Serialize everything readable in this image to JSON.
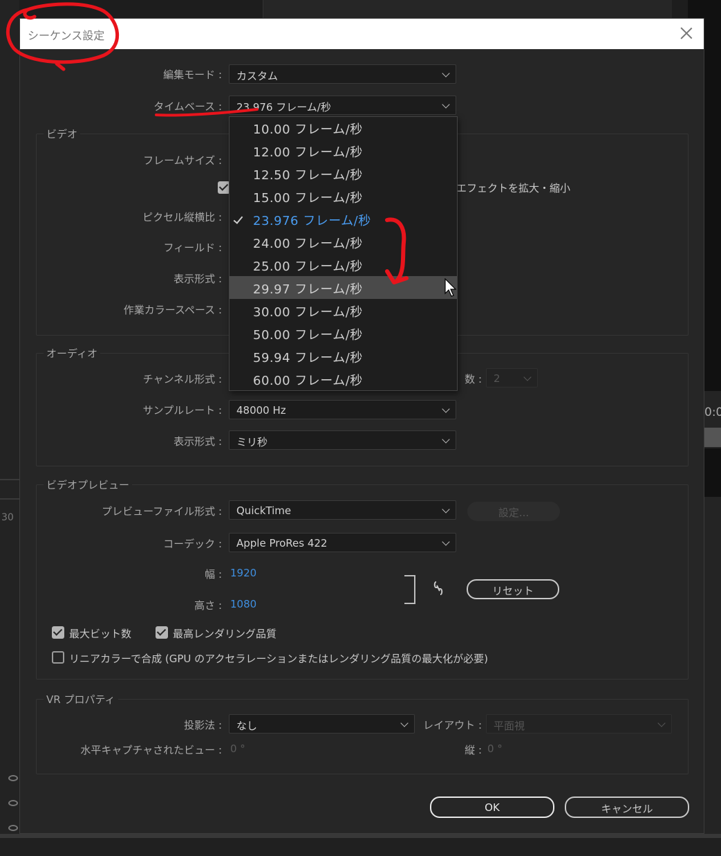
{
  "dialog": {
    "title": "シーケンス設定",
    "close_icon": "close-icon"
  },
  "editing_mode": {
    "label": "編集モード",
    "value": "カスタム"
  },
  "timebase": {
    "label": "タイムベース",
    "value": "23.976  フレーム/秒",
    "options": [
      "10.00  フレーム/秒",
      "12.00  フレーム/秒",
      "12.50  フレーム/秒",
      "15.00  フレーム/秒",
      "23.976  フレーム/秒",
      "24.00  フレーム/秒",
      "25.00  フレーム/秒",
      "29.97  フレーム/秒",
      "30.00  フレーム/秒",
      "50.00  フレーム/秒",
      "59.94  フレーム/秒",
      "60.00  フレーム/秒"
    ],
    "selected_index": 4,
    "hovered_index": 7
  },
  "video": {
    "group_title": "ビデオ",
    "frame_size_label": "フレームサイズ",
    "scale_note": "エフェクトを拡大・縮小",
    "pixel_aspect_label": "ピクセル縦横比",
    "fields_label": "フィールド",
    "display_format_label": "表示形式",
    "color_space_label": "作業カラースペース"
  },
  "audio": {
    "group_title": "オーディオ",
    "channel_format_label": "チャンネル形式",
    "channels_suffix": "数",
    "channels_value": "2",
    "sample_rate_label": "サンプルレート",
    "sample_rate_value": "48000 Hz",
    "display_format_label": "表示形式",
    "display_format_value": "ミリ秒"
  },
  "video_preview": {
    "group_title": "ビデオプレビュー",
    "preview_format_label": "プレビューファイル形式",
    "preview_format_value": "QuickTime",
    "settings_button": "設定...",
    "codec_label": "コーデック",
    "codec_value": "Apple ProRes 422",
    "width_label": "幅",
    "width_value": "1920",
    "height_label": "高さ",
    "height_value": "1080",
    "reset_button": "リセット",
    "max_bit_depth": {
      "label": "最大ビット数",
      "checked": true
    },
    "max_render_quality": {
      "label": "最高レンダリング品質",
      "checked": true
    },
    "linear_color": {
      "label": "リニアカラーで合成 (GPU のアクセラレーションまたはレンダリング品質の最大化が必要)",
      "checked": false
    }
  },
  "vr": {
    "group_title": "VR プロパティ",
    "projection_label": "投影法",
    "projection_value": "なし",
    "layout_label": "レイアウト",
    "layout_value": "平面視",
    "h_view_label": "水平キャプチャされたビュー",
    "h_view_value": "0 °",
    "vertical_label": "縦",
    "vertical_value": "0 °"
  },
  "buttons": {
    "ok": "OK",
    "cancel": "キャンセル"
  },
  "background": {
    "timecode": "0:0",
    "ruler_number": "30"
  },
  "colors": {
    "accent": "#3f8fe0",
    "annotation_red": "#e8141c"
  }
}
